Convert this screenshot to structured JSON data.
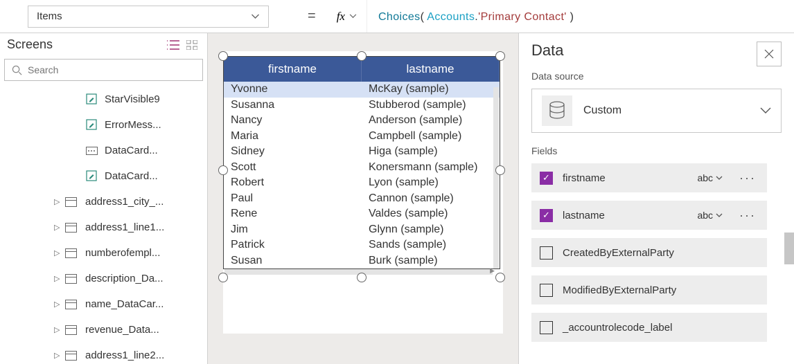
{
  "formula_bar": {
    "property": "Items",
    "fn": "Choices",
    "paren_open": "( ",
    "id": "Accounts",
    "dot": ".",
    "prop": "'Primary Contact'",
    "paren_close": " )"
  },
  "screens": {
    "title": "Screens",
    "search_placeholder": "Search",
    "leaves": [
      "StarVisible9",
      "ErrorMess...",
      "DataCard...",
      "DataCard..."
    ],
    "nodes": [
      "address1_city_...",
      "address1_line1...",
      "numberofempl...",
      "description_Da...",
      "name_DataCar...",
      "revenue_Data...",
      "address1_line2..."
    ]
  },
  "datatable": {
    "headers": [
      "firstname",
      "lastname"
    ],
    "rows": [
      {
        "fn": "Yvonne",
        "ln": "McKay (sample)",
        "sel": true
      },
      {
        "fn": "Susanna",
        "ln": "Stubberod (sample)"
      },
      {
        "fn": "Nancy",
        "ln": "Anderson (sample)"
      },
      {
        "fn": "Maria",
        "ln": "Campbell (sample)"
      },
      {
        "fn": "Sidney",
        "ln": "Higa (sample)"
      },
      {
        "fn": "Scott",
        "ln": "Konersmann (sample)"
      },
      {
        "fn": "Robert",
        "ln": "Lyon (sample)"
      },
      {
        "fn": "Paul",
        "ln": "Cannon (sample)"
      },
      {
        "fn": "Rene",
        "ln": "Valdes (sample)"
      },
      {
        "fn": "Jim",
        "ln": "Glynn (sample)"
      },
      {
        "fn": "Patrick",
        "ln": "Sands (sample)"
      },
      {
        "fn": "Susan",
        "ln": "Burk (sample)"
      }
    ]
  },
  "data_panel": {
    "title": "Data",
    "sub": "Data source",
    "ds_name": "Custom",
    "fields_title": "Fields",
    "fields": [
      {
        "name": "firstname",
        "checked": true,
        "type": "abc"
      },
      {
        "name": "lastname",
        "checked": true,
        "type": "abc"
      },
      {
        "name": "CreatedByExternalParty",
        "checked": false
      },
      {
        "name": "ModifiedByExternalParty",
        "checked": false
      },
      {
        "name": "_accountrolecode_label",
        "checked": false
      }
    ]
  }
}
